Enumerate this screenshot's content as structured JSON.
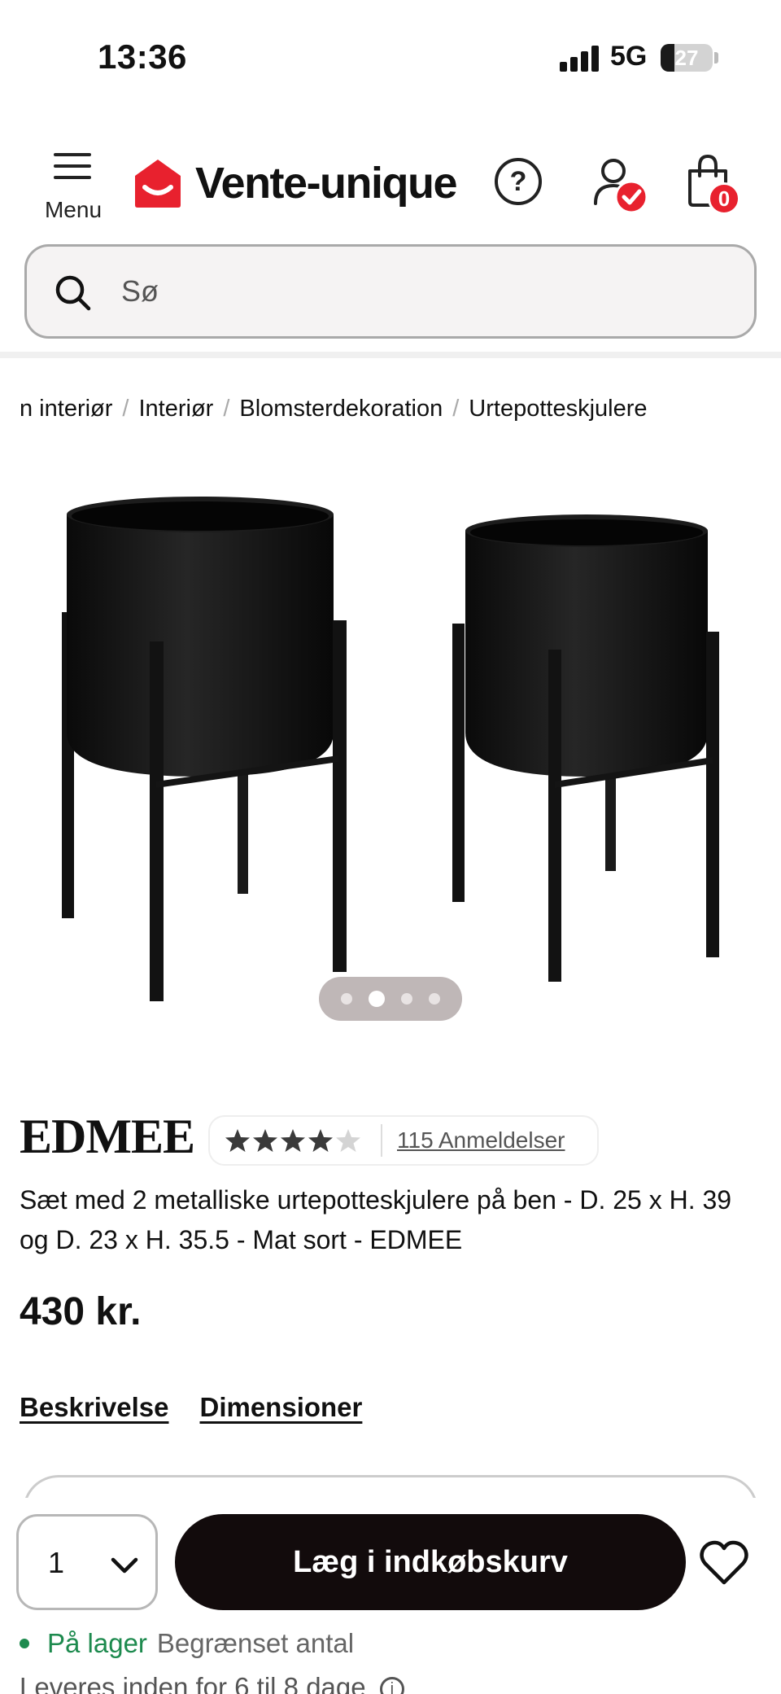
{
  "status_bar": {
    "time": "13:36",
    "network": "5G",
    "battery": "27",
    "battery_fraction": 0.27
  },
  "header": {
    "menu_label": "Menu",
    "logo_text": "Vente-unique",
    "help_icon": "question-circle-icon",
    "account_icon": "user-check-icon",
    "cart_icon": "shopping-bag-icon",
    "cart_count": "0",
    "accent_color": "#e8212e"
  },
  "search": {
    "placeholder": "Sø"
  },
  "breadcrumb": {
    "items": [
      "n interiør",
      "Interiør",
      "Blomsterdekoration",
      "Urtepotteskjulere"
    ],
    "separator": "/"
  },
  "gallery": {
    "slide_count": 4,
    "active_slide": 2
  },
  "product": {
    "name": "EDMEE",
    "rating": 4.5,
    "reviews_label": "115 Anmeldelser",
    "description": "Sæt med 2 metalliske urtepotteskjulere på ben - D. 25 x H. 39 og D. 23 x H. 35.5 - Mat sort - EDMEE",
    "price": "430 kr."
  },
  "tabs": {
    "description_label": "Beskrivelse",
    "dimensions_label": "Dimensioner"
  },
  "cart_bar": {
    "quantity": "1",
    "add_label": "Læg i indkøbskurv",
    "wishlist_icon": "heart-icon"
  },
  "stock": {
    "status": "På lager",
    "note": "Begrænset antal",
    "status_color": "#1d8a4e",
    "delivery": "Leveres inden for 6 til 8 dage"
  }
}
